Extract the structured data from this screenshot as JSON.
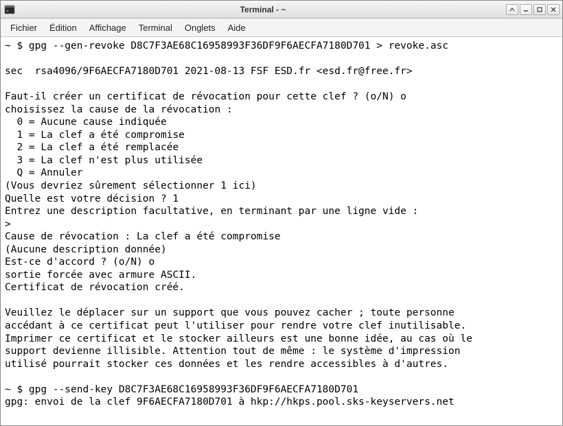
{
  "window": {
    "title": "Terminal - ~"
  },
  "menubar": {
    "items": [
      "Fichier",
      "Édition",
      "Affichage",
      "Terminal",
      "Onglets",
      "Aide"
    ]
  },
  "terminal": {
    "prompt1": "~ $ ",
    "cmd1": "gpg --gen-revoke D8C7F3AE68C16958993F36DF9F6AECFA7180D701 > revoke.asc",
    "blank1": "",
    "line_sec": "sec  rsa4096/9F6AECFA7180D701 2021-08-13 FSF ESD.fr <esd.fr@free.fr>",
    "blank2": "",
    "q1": "Faut-il créer un certificat de révocation pour cette clef ? (o/N) o",
    "choose": "choisissez la cause de la révocation :",
    "opt0": "  0 = Aucune cause indiquée",
    "opt1": "  1 = La clef a été compromise",
    "opt2": "  2 = La clef a été remplacée",
    "opt3": "  3 = La clef n'est plus utilisée",
    "optQ": "  Q = Annuler",
    "hint": "(Vous devriez sûrement sélectionner 1 ici)",
    "decision": "Quelle est votre décision ? 1",
    "desc_prompt": "Entrez une description facultative, en terminant par une ligne vide :",
    "desc_input": "> ",
    "cause": "Cause de révocation : La clef a été compromise",
    "nodesc": "(Aucune description donnée)",
    "confirm": "Est-ce d'accord ? (o/N) o",
    "ascii": "sortie forcée avec armure ASCII.",
    "created": "Certificat de révocation créé.",
    "blank3": "",
    "warn1": "Veuillez le déplacer sur un support que vous pouvez cacher ; toute personne",
    "warn2": "accédant à ce certificat peut l'utiliser pour rendre votre clef inutilisable.",
    "warn3": "Imprimer ce certificat et le stocker ailleurs est une bonne idée, au cas où le",
    "warn4": "support devienne illisible. Attention tout de même : le système d'impression",
    "warn5": "utilisé pourrait stocker ces données et les rendre accessibles à d'autres.",
    "blank4": "",
    "prompt2": "~ $ ",
    "cmd2": "gpg --send-key D8C7F3AE68C16958993F36DF9F6AECFA7180D701",
    "send_out": "gpg: envoi de la clef 9F6AECFA7180D701 à hkp://hkps.pool.sks-keyservers.net"
  }
}
